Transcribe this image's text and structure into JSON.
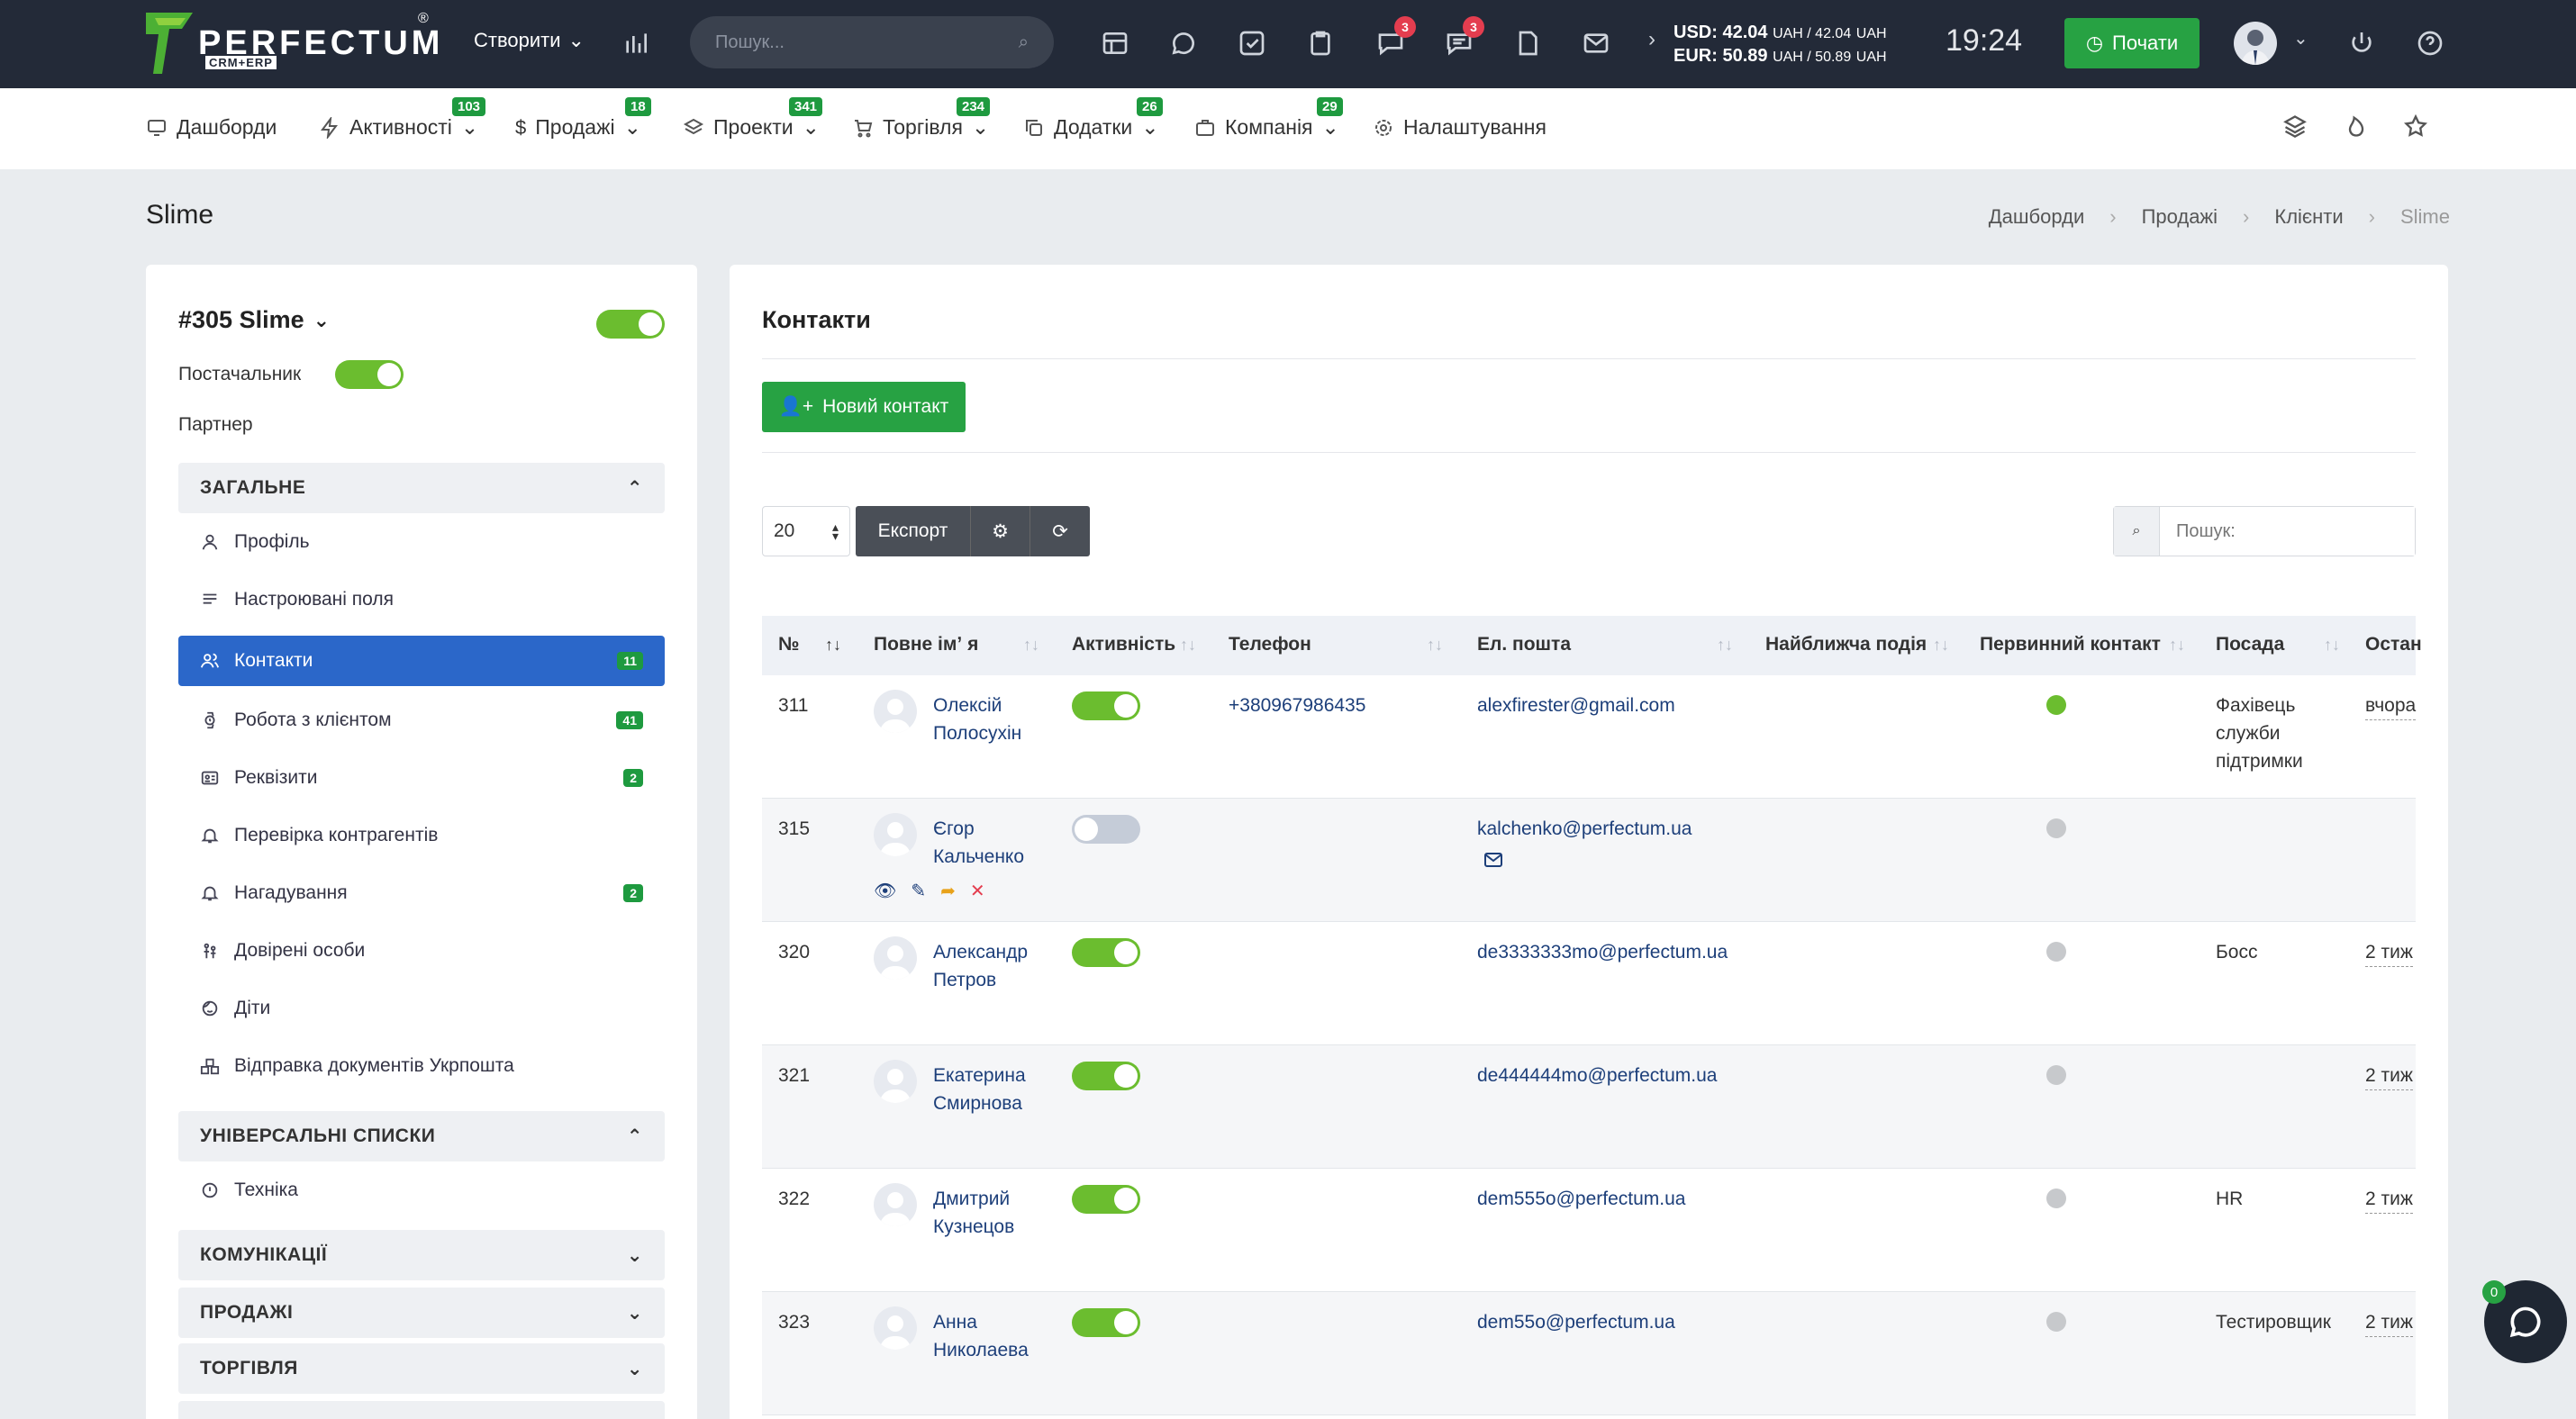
{
  "topbar": {
    "logo_text": "PERFECTUM",
    "logo_sub": "CRM+ERP",
    "create_label": "Створити",
    "search_placeholder": "Пошук...",
    "badges": {
      "chat": "3",
      "messages": "3"
    },
    "currency_usd": "USD: 42.04",
    "currency_usd_rest": "UAH / 42.04",
    "currency_usd_unit": "UAH",
    "currency_eur": "EUR: 50.89",
    "currency_eur_rest": "UAH / 50.89",
    "currency_eur_unit": "UAH",
    "clock": "19:24",
    "start_label": "Почати"
  },
  "nav": {
    "items": [
      {
        "label": "Дашборди",
        "badge": ""
      },
      {
        "label": "Активності",
        "badge": "103"
      },
      {
        "label": "Продажі",
        "badge": "18"
      },
      {
        "label": "Проекти",
        "badge": "341"
      },
      {
        "label": "Торгівля",
        "badge": "234"
      },
      {
        "label": "Додатки",
        "badge": "26"
      },
      {
        "label": "Компанія",
        "badge": "29"
      },
      {
        "label": "Налаштування",
        "badge": ""
      }
    ]
  },
  "page": {
    "title": "Slime",
    "breadcrumb": [
      "Дашборди",
      "Продажі",
      "Клієнти",
      "Slime"
    ]
  },
  "sidebar": {
    "client_name": "#305 Slime",
    "supplier_label": "Постачальник",
    "partner_label": "Партнер",
    "section_general": "ЗАГАЛЬНЕ",
    "items": [
      {
        "label": "Профіль",
        "count": ""
      },
      {
        "label": "Настроювані поля",
        "count": ""
      },
      {
        "label": "Контакти",
        "count": "11"
      },
      {
        "label": "Робота з клієнтом",
        "count": "41"
      },
      {
        "label": "Реквізити",
        "count": "2"
      },
      {
        "label": "Перевірка контрагентів",
        "count": ""
      },
      {
        "label": "Нагадування",
        "count": "2"
      },
      {
        "label": "Довірені особи",
        "count": ""
      },
      {
        "label": "Діти",
        "count": ""
      },
      {
        "label": "Відправка документів Укрпошта",
        "count": ""
      }
    ],
    "section_universal": "УНІВЕРСАЛЬНІ СПИСКИ",
    "universal_item": "Техніка",
    "section_comm": "КОМУНІКАЦІЇ",
    "section_sales": "ПРОДАЖІ",
    "section_trade": "ТОРГІВЛЯ"
  },
  "contacts": {
    "title": "Контакти",
    "new_button": "Новий контакт",
    "per_page": "20",
    "export_label": "Експорт",
    "search_placeholder": "Пошук:",
    "columns": [
      "№",
      "Повне імʼ я",
      "Активність",
      "Телефон",
      "Ел. пошта",
      "Найближча подія",
      "Первинний контакт",
      "Посада",
      "Остан"
    ],
    "rows": [
      {
        "id": "311",
        "name1": "Олексій",
        "name2": "Полосухін",
        "active": true,
        "phone": "+380967986435",
        "email": "alexfirester@gmail.com",
        "primary": true,
        "position1": "Фахівець",
        "position2": "служби",
        "position3": "підтримки",
        "last": "вчора"
      },
      {
        "id": "315",
        "name1": "Єгор",
        "name2": "Кальченко",
        "active": false,
        "phone": "",
        "email": "kalchenko@perfectum.ua",
        "primary": false,
        "position1": "",
        "position2": "",
        "position3": "",
        "last": ""
      },
      {
        "id": "320",
        "name1": "Александр",
        "name2": "Петров",
        "active": true,
        "phone": "",
        "email": "de3333333mo@perfectum.ua",
        "primary": false,
        "position1": "Босс",
        "position2": "",
        "position3": "",
        "last": "2 тиж"
      },
      {
        "id": "321",
        "name1": "Екатерина",
        "name2": "Смирнова",
        "active": true,
        "phone": "",
        "email": "de444444mo@perfectum.ua",
        "primary": false,
        "position1": "",
        "position2": "",
        "position3": "",
        "last": "2 тиж"
      },
      {
        "id": "322",
        "name1": "Дмитрий",
        "name2": "Кузнецов",
        "active": true,
        "phone": "",
        "email": "dem555o@perfectum.ua",
        "primary": false,
        "position1": "HR",
        "position2": "",
        "position3": "",
        "last": "2 тиж"
      },
      {
        "id": "323",
        "name1": "Анна",
        "name2": "Николаева",
        "active": true,
        "phone": "",
        "email": "dem55o@perfectum.ua",
        "primary": false,
        "position1": "Тестировщик",
        "position2": "",
        "position3": "",
        "last": "2 тиж"
      }
    ]
  },
  "chat": {
    "badge": "0"
  },
  "colors": {
    "topbar": "#232a38",
    "green": "#27a243",
    "active_blue": "#2b67c9",
    "toggle_on": "#6bbd2f"
  }
}
